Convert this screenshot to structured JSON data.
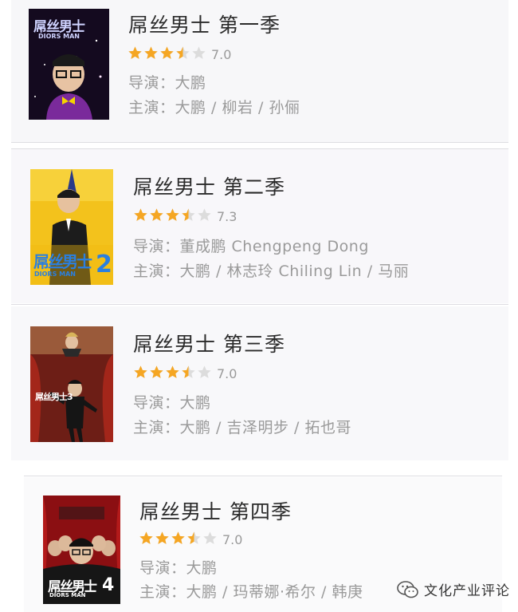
{
  "colors": {
    "star_filled": "#f5a623",
    "star_empty": "#dcdcdc",
    "title": "#2b2b2b",
    "meta": "#9a9a9a"
  },
  "items": [
    {
      "title": "屌丝男士 第一季",
      "rating": "7.0",
      "stars": 3.5,
      "director": "导演：大鹏",
      "cast": "主演：大鹏 / 柳岩 / 孙俪",
      "poster_text": "屌丝男士",
      "poster_sub": "DIORS MAN"
    },
    {
      "title": "屌丝男士 第二季",
      "rating": "7.3",
      "stars": 3.5,
      "director": "导演：董成鹏  Chengpeng Dong",
      "cast": "主演：大鹏 / 林志玲 Chiling Lin / 马丽",
      "poster_text": "屌丝男士",
      "poster_sub": "DIORS MAN",
      "poster_num": "2"
    },
    {
      "title": "屌丝男士 第三季",
      "rating": "7.0",
      "stars": 3.5,
      "director": "导演：大鹏",
      "cast": "主演：大鹏 / 吉泽明步 / 拓也哥",
      "poster_text": "屌丝男士3"
    },
    {
      "title": "屌丝男士 第四季",
      "rating": "7.0",
      "stars": 3.5,
      "director": "导演：大鹏",
      "cast": "主演：大鹏 / 玛蒂娜·希尔 / 韩庚",
      "poster_text": "屌丝男士",
      "poster_sub": "DIORS MAN",
      "poster_num": "4"
    }
  ],
  "watermark": {
    "text": "文化产业评论",
    "icon": "wechat-icon"
  }
}
